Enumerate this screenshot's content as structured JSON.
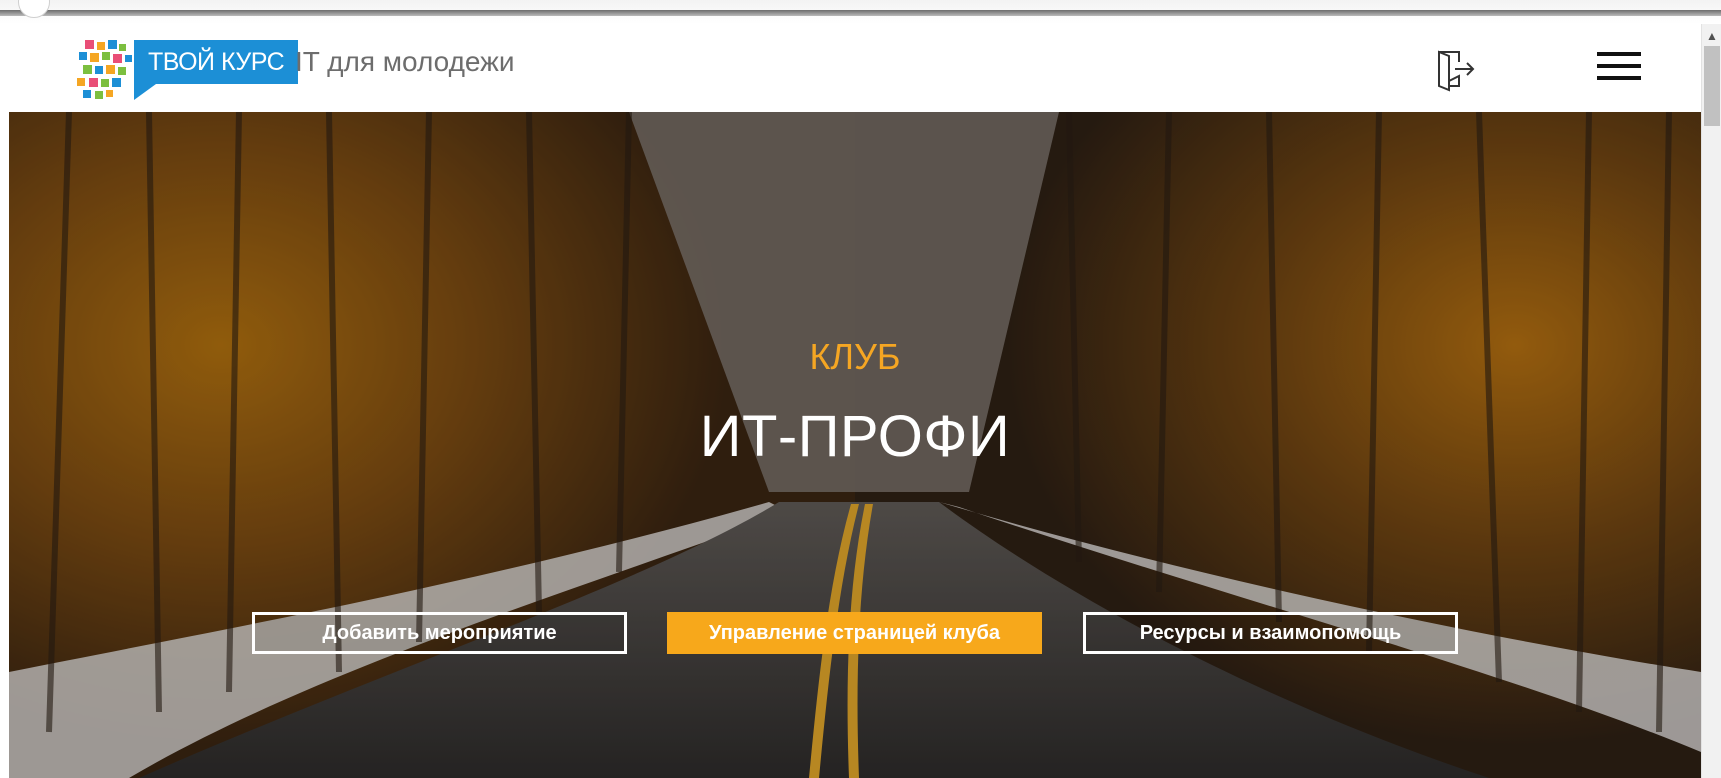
{
  "header": {
    "brand_badge": "ТВОЙ КУРС",
    "tagline": "IT для молодежи",
    "logo_icon": "mosaic-logo-icon",
    "exit_icon": "logout-door-icon",
    "menu_icon": "hamburger-menu-icon"
  },
  "hero": {
    "kicker": "КЛУБ",
    "title": "ИТ-ПРОФИ",
    "buttons": [
      {
        "label": "Добавить мероприятие",
        "style": "outline"
      },
      {
        "label": "Управление страницей клуба",
        "style": "primary"
      },
      {
        "label": "Ресурсы и взаимопомощь",
        "style": "outline"
      }
    ]
  },
  "colors": {
    "brand_blue": "#1c8fd6",
    "accent_orange": "#f7a81b",
    "kicker_orange": "#f5a623",
    "tagline_gray": "#6d6d6d"
  }
}
